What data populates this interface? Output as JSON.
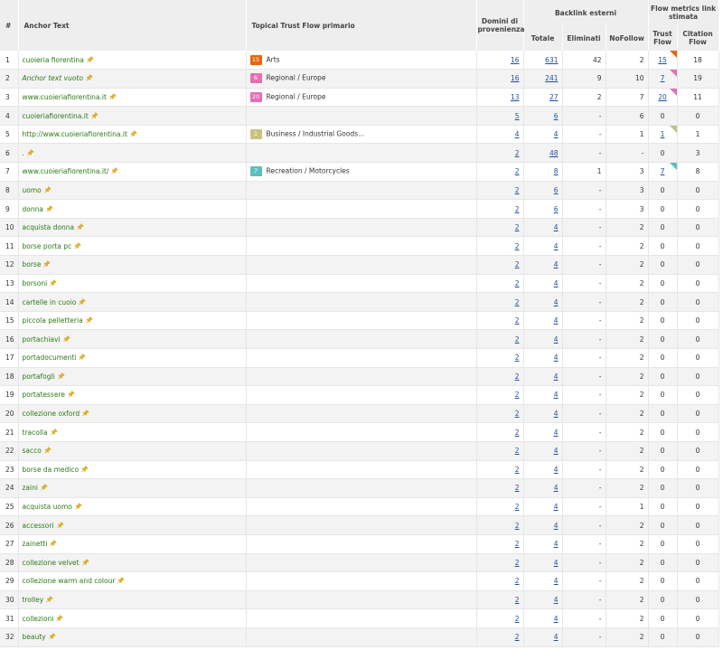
{
  "headers": {
    "index": "#",
    "anchor": "Anchor Text",
    "topical": "Topical Trust Flow primario",
    "domains": "Domini di provenienza",
    "backlinks_group": "Backlink esterni",
    "total": "Totale",
    "deleted": "Eliminati",
    "nofollow": "NoFollow",
    "flow_group": "Flow metrics link stimata",
    "trust_flow": "Trust Flow",
    "citation_flow": "Citation Flow"
  },
  "colors": {
    "arts": "#e8650c",
    "regional": "#e56fb4",
    "business": "#c8c27e",
    "recreation": "#5bbfbf"
  },
  "rows": [
    {
      "i": "1",
      "anchor": "cuoieria fiorentina",
      "italic": false,
      "topic_score": "15",
      "topic": "Arts",
      "topic_color": "#e8650c",
      "domains": "16",
      "total": "631",
      "deleted": "42",
      "nofollow": "2",
      "tf": "15",
      "cf": "18",
      "corner": "#e8650c"
    },
    {
      "i": "2",
      "anchor": "Anchor text vuoto",
      "italic": true,
      "topic_score": "6",
      "topic": "Regional / Europe",
      "topic_color": "#e56fb4",
      "domains": "16",
      "total": "241",
      "deleted": "9",
      "nofollow": "10",
      "tf": "7",
      "cf": "19",
      "corner": "#e56fb4"
    },
    {
      "i": "3",
      "anchor": "www.cuoieriafiorentina.it",
      "italic": false,
      "topic_score": "20",
      "topic": "Regional / Europe",
      "topic_color": "#e56fb4",
      "domains": "13",
      "total": "27",
      "deleted": "2",
      "nofollow": "7",
      "tf": "20",
      "cf": "11",
      "corner": "#e56fb4"
    },
    {
      "i": "4",
      "anchor": "cuoieriafiorentina.it",
      "italic": false,
      "topic_score": "",
      "topic": "",
      "topic_color": "",
      "domains": "5",
      "total": "6",
      "deleted": "-",
      "nofollow": "6",
      "tf": "0",
      "cf": "0",
      "corner": ""
    },
    {
      "i": "5",
      "anchor": "http://www.cuoieriafiorentina.it",
      "italic": false,
      "topic_score": "1",
      "topic": "Business / Industrial Goods...",
      "topic_color": "#c8c27e",
      "domains": "4",
      "total": "4",
      "deleted": "-",
      "nofollow": "1",
      "tf": "1",
      "cf": "1",
      "corner": "#b9c48a"
    },
    {
      "i": "6",
      "anchor": ".",
      "italic": false,
      "topic_score": "",
      "topic": "",
      "topic_color": "",
      "domains": "2",
      "total": "48",
      "deleted": "-",
      "nofollow": "-",
      "tf": "0",
      "cf": "3",
      "corner": ""
    },
    {
      "i": "7",
      "anchor": "www.cuoieriafiorentina.it/",
      "italic": false,
      "topic_score": "7",
      "topic": "Recreation / Motorcycles",
      "topic_color": "#5bbfbf",
      "domains": "2",
      "total": "8",
      "deleted": "1",
      "nofollow": "3",
      "tf": "7",
      "cf": "8",
      "corner": "#5bbfbf"
    },
    {
      "i": "8",
      "anchor": "uomo",
      "italic": false,
      "topic_score": "",
      "topic": "",
      "topic_color": "",
      "domains": "2",
      "total": "6",
      "deleted": "-",
      "nofollow": "3",
      "tf": "0",
      "cf": "0",
      "corner": ""
    },
    {
      "i": "9",
      "anchor": "donna",
      "italic": false,
      "topic_score": "",
      "topic": "",
      "topic_color": "",
      "domains": "2",
      "total": "6",
      "deleted": "-",
      "nofollow": "3",
      "tf": "0",
      "cf": "0",
      "corner": ""
    },
    {
      "i": "10",
      "anchor": "acquista donna",
      "italic": false,
      "topic_score": "",
      "topic": "",
      "topic_color": "",
      "domains": "2",
      "total": "4",
      "deleted": "-",
      "nofollow": "2",
      "tf": "0",
      "cf": "0",
      "corner": ""
    },
    {
      "i": "11",
      "anchor": "borse porta pc",
      "italic": false,
      "topic_score": "",
      "topic": "",
      "topic_color": "",
      "domains": "2",
      "total": "4",
      "deleted": "-",
      "nofollow": "2",
      "tf": "0",
      "cf": "0",
      "corner": ""
    },
    {
      "i": "12",
      "anchor": "borse",
      "italic": false,
      "topic_score": "",
      "topic": "",
      "topic_color": "",
      "domains": "2",
      "total": "4",
      "deleted": "-",
      "nofollow": "2",
      "tf": "0",
      "cf": "0",
      "corner": ""
    },
    {
      "i": "13",
      "anchor": "borsoni",
      "italic": false,
      "topic_score": "",
      "topic": "",
      "topic_color": "",
      "domains": "2",
      "total": "4",
      "deleted": "-",
      "nofollow": "2",
      "tf": "0",
      "cf": "0",
      "corner": ""
    },
    {
      "i": "14",
      "anchor": "cartelle in cuoio",
      "italic": false,
      "topic_score": "",
      "topic": "",
      "topic_color": "",
      "domains": "2",
      "total": "4",
      "deleted": "-",
      "nofollow": "2",
      "tf": "0",
      "cf": "0",
      "corner": ""
    },
    {
      "i": "15",
      "anchor": "piccola pelletteria",
      "italic": false,
      "topic_score": "",
      "topic": "",
      "topic_color": "",
      "domains": "2",
      "total": "4",
      "deleted": "-",
      "nofollow": "2",
      "tf": "0",
      "cf": "0",
      "corner": ""
    },
    {
      "i": "16",
      "anchor": "portachiavi",
      "italic": false,
      "topic_score": "",
      "topic": "",
      "topic_color": "",
      "domains": "2",
      "total": "4",
      "deleted": "-",
      "nofollow": "2",
      "tf": "0",
      "cf": "0",
      "corner": ""
    },
    {
      "i": "17",
      "anchor": "portadocumenti",
      "italic": false,
      "topic_score": "",
      "topic": "",
      "topic_color": "",
      "domains": "2",
      "total": "4",
      "deleted": "-",
      "nofollow": "2",
      "tf": "0",
      "cf": "0",
      "corner": ""
    },
    {
      "i": "18",
      "anchor": "portafogli",
      "italic": false,
      "topic_score": "",
      "topic": "",
      "topic_color": "",
      "domains": "2",
      "total": "4",
      "deleted": "-",
      "nofollow": "2",
      "tf": "0",
      "cf": "0",
      "corner": ""
    },
    {
      "i": "19",
      "anchor": "portatessere",
      "italic": false,
      "topic_score": "",
      "topic": "",
      "topic_color": "",
      "domains": "2",
      "total": "4",
      "deleted": "-",
      "nofollow": "2",
      "tf": "0",
      "cf": "0",
      "corner": ""
    },
    {
      "i": "20",
      "anchor": "collezione oxford",
      "italic": false,
      "topic_score": "",
      "topic": "",
      "topic_color": "",
      "domains": "2",
      "total": "4",
      "deleted": "-",
      "nofollow": "2",
      "tf": "0",
      "cf": "0",
      "corner": ""
    },
    {
      "i": "21",
      "anchor": "tracolla",
      "italic": false,
      "topic_score": "",
      "topic": "",
      "topic_color": "",
      "domains": "2",
      "total": "4",
      "deleted": "-",
      "nofollow": "2",
      "tf": "0",
      "cf": "0",
      "corner": ""
    },
    {
      "i": "22",
      "anchor": "sacco",
      "italic": false,
      "topic_score": "",
      "topic": "",
      "topic_color": "",
      "domains": "2",
      "total": "4",
      "deleted": "-",
      "nofollow": "2",
      "tf": "0",
      "cf": "0",
      "corner": ""
    },
    {
      "i": "23",
      "anchor": "borse da medico",
      "italic": false,
      "topic_score": "",
      "topic": "",
      "topic_color": "",
      "domains": "2",
      "total": "4",
      "deleted": "-",
      "nofollow": "2",
      "tf": "0",
      "cf": "0",
      "corner": ""
    },
    {
      "i": "24",
      "anchor": "zaini",
      "italic": false,
      "topic_score": "",
      "topic": "",
      "topic_color": "",
      "domains": "2",
      "total": "4",
      "deleted": "-",
      "nofollow": "2",
      "tf": "0",
      "cf": "0",
      "corner": ""
    },
    {
      "i": "25",
      "anchor": "acquista uomo",
      "italic": false,
      "topic_score": "",
      "topic": "",
      "topic_color": "",
      "domains": "2",
      "total": "4",
      "deleted": "-",
      "nofollow": "1",
      "tf": "0",
      "cf": "0",
      "corner": ""
    },
    {
      "i": "26",
      "anchor": "accessori",
      "italic": false,
      "topic_score": "",
      "topic": "",
      "topic_color": "",
      "domains": "2",
      "total": "4",
      "deleted": "-",
      "nofollow": "2",
      "tf": "0",
      "cf": "0",
      "corner": ""
    },
    {
      "i": "27",
      "anchor": "zainetti",
      "italic": false,
      "topic_score": "",
      "topic": "",
      "topic_color": "",
      "domains": "2",
      "total": "4",
      "deleted": "-",
      "nofollow": "2",
      "tf": "0",
      "cf": "0",
      "corner": ""
    },
    {
      "i": "28",
      "anchor": "collezione velvet",
      "italic": false,
      "topic_score": "",
      "topic": "",
      "topic_color": "",
      "domains": "2",
      "total": "4",
      "deleted": "-",
      "nofollow": "2",
      "tf": "0",
      "cf": "0",
      "corner": ""
    },
    {
      "i": "29",
      "anchor": "collezione warm and colour",
      "italic": false,
      "topic_score": "",
      "topic": "",
      "topic_color": "",
      "domains": "2",
      "total": "4",
      "deleted": "-",
      "nofollow": "2",
      "tf": "0",
      "cf": "0",
      "corner": ""
    },
    {
      "i": "30",
      "anchor": "trolley",
      "italic": false,
      "topic_score": "",
      "topic": "",
      "topic_color": "",
      "domains": "2",
      "total": "4",
      "deleted": "-",
      "nofollow": "2",
      "tf": "0",
      "cf": "0",
      "corner": ""
    },
    {
      "i": "31",
      "anchor": "collezioni",
      "italic": false,
      "topic_score": "",
      "topic": "",
      "topic_color": "",
      "domains": "2",
      "total": "4",
      "deleted": "-",
      "nofollow": "2",
      "tf": "0",
      "cf": "0",
      "corner": ""
    },
    {
      "i": "32",
      "anchor": "beauty",
      "italic": false,
      "topic_score": "",
      "topic": "",
      "topic_color": "",
      "domains": "2",
      "total": "4",
      "deleted": "-",
      "nofollow": "2",
      "tf": "0",
      "cf": "0",
      "corner": ""
    }
  ]
}
